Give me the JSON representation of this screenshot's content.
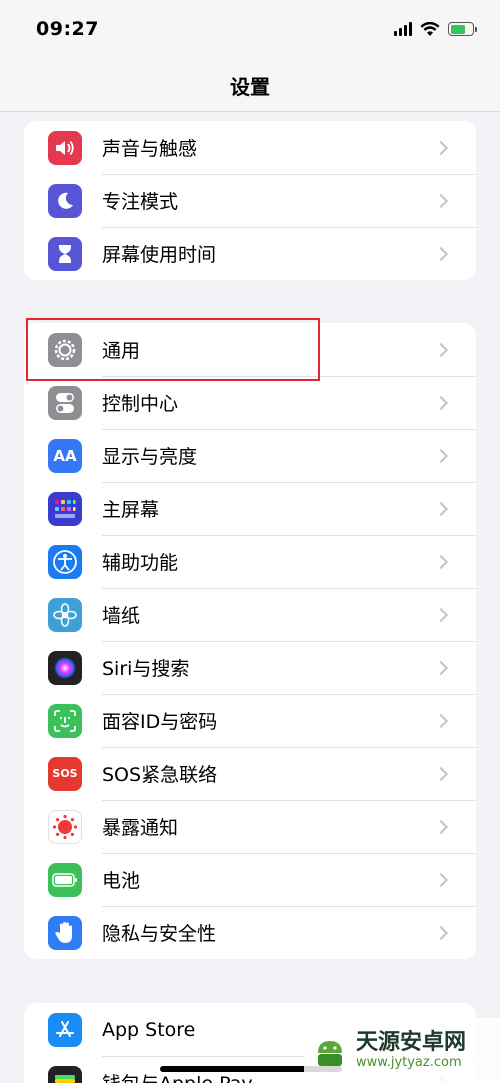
{
  "status_bar": {
    "time": "09:27",
    "battery_color": "#34c759"
  },
  "nav": {
    "title": "设置"
  },
  "group1": [
    {
      "label": "声音与触感",
      "icon": "speaker-icon",
      "color": "#e5384f"
    },
    {
      "label": "专注模式",
      "icon": "moon-icon",
      "color": "#5856d6"
    },
    {
      "label": "屏幕使用时间",
      "icon": "hourglass-icon",
      "color": "#5856d6"
    }
  ],
  "group2": [
    {
      "label": "通用",
      "icon": "gear-icon",
      "color": "#8e8e93"
    },
    {
      "label": "控制中心",
      "icon": "toggle-icon",
      "color": "#8e8e93"
    },
    {
      "label": "显示与亮度",
      "icon": "aa-icon",
      "color": "#3478f6"
    },
    {
      "label": "主屏幕",
      "icon": "home-grid-icon",
      "color": "#3a3ccf"
    },
    {
      "label": "辅助功能",
      "icon": "accessibility-icon",
      "color": "#1a7cf0"
    },
    {
      "label": "墙纸",
      "icon": "flower-icon",
      "color": "#3fa0d8"
    },
    {
      "label": "Siri与搜索",
      "icon": "siri-icon",
      "color": "#222222"
    },
    {
      "label": "面容ID与密码",
      "icon": "face-id-icon",
      "color": "#3cc15a"
    },
    {
      "label": "SOS紧急联络",
      "icon": "sos-icon",
      "color": "#e5392f"
    },
    {
      "label": "暴露通知",
      "icon": "exposure-icon",
      "color": "#ffffff"
    },
    {
      "label": "电池",
      "icon": "battery-icon",
      "color": "#3cc15a"
    },
    {
      "label": "隐私与安全性",
      "icon": "hand-icon",
      "color": "#2f7cf6"
    }
  ],
  "group3": [
    {
      "label": "App Store",
      "icon": "app-store-icon",
      "color": "#1a8cf5"
    },
    {
      "label": "钱包与Apple Pay",
      "icon": "wallet-icon",
      "color": "#222222"
    }
  ],
  "icon_text": {
    "aa": "AA",
    "sos": "SOS"
  },
  "watermark": {
    "title": "天源安卓网",
    "url": "www.jytyaz.com"
  }
}
